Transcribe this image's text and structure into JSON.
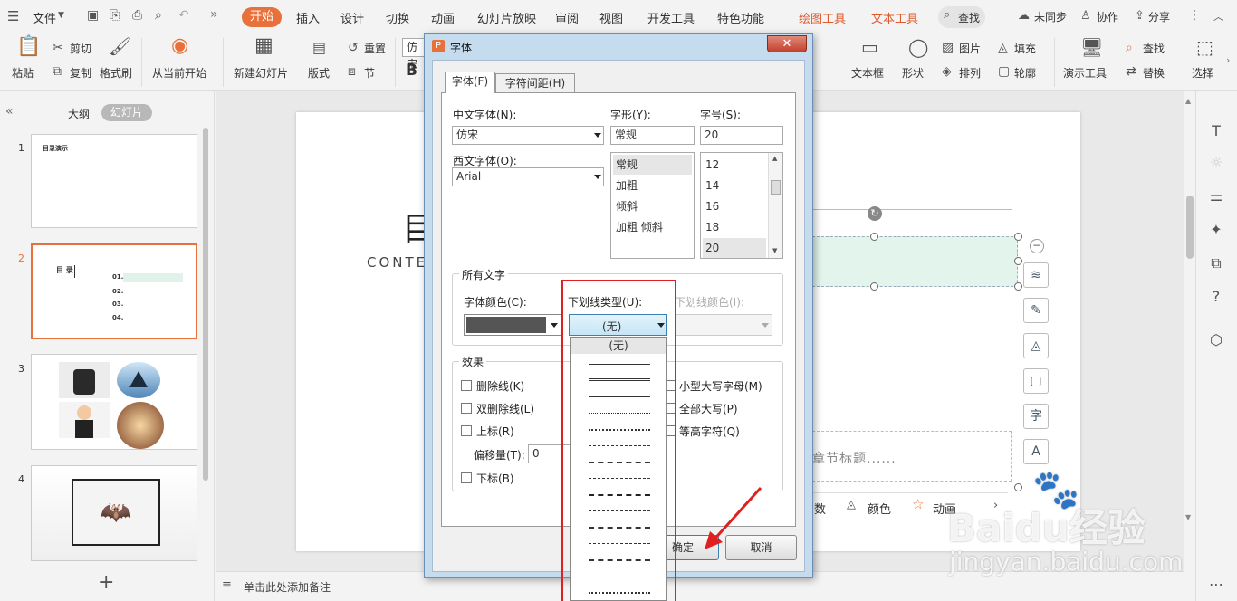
{
  "menubar": {
    "file": "文件",
    "more": "»",
    "tabs": [
      "开始",
      "插入",
      "设计",
      "切换",
      "动画",
      "幻灯片放映",
      "审阅",
      "视图",
      "开发工具",
      "特色功能"
    ],
    "tool_tabs": [
      "绘图工具",
      "文本工具"
    ],
    "search": "查找",
    "sync": "未同步",
    "collab": "协作",
    "share": "分享"
  },
  "ribbon": {
    "paste": "粘贴",
    "cut": "剪切",
    "copy": "复制",
    "format_painter": "格式刷",
    "from_current": "从当前开始",
    "new_slide": "新建幻灯片",
    "layout": "版式",
    "reset": "重置",
    "section": "节",
    "font_name": "仿宋",
    "bold": "B",
    "textbox": "文本框",
    "shape": "形状",
    "picture": "图片",
    "arrange": "排列",
    "fill": "填充",
    "outline": "轮廓",
    "present_tools": "演示工具",
    "find": "查找",
    "replace": "替换",
    "select": "选择"
  },
  "leftpanel": {
    "outline_tab": "大纲",
    "slides_tab": "幻灯片",
    "slide_numbers": [
      "1",
      "2",
      "3",
      "4"
    ],
    "thumb1_title": "目录演示",
    "thumb2_title": "目 录",
    "thumb2_items": [
      "01.",
      "02.",
      "03.",
      "04."
    ],
    "add": "+"
  },
  "slide": {
    "title_char": "目",
    "subtitle": "CONTE",
    "chapter_placeholder": "章节标题......",
    "toolbar_items": [
      "数",
      "颜色",
      "动画"
    ]
  },
  "notes": {
    "placeholder": "单击此处添加备注"
  },
  "dialog": {
    "title": "字体",
    "tabs": [
      "字体(F)",
      "字符间距(H)"
    ],
    "cn_font_label": "中文字体(N):",
    "cn_font_value": "仿宋",
    "style_label": "字形(Y):",
    "style_value": "常规",
    "size_label": "字号(S):",
    "size_value": "20",
    "west_font_label": "西文字体(O):",
    "west_font_value": "Arial",
    "style_options": [
      "常规",
      "加粗",
      "倾斜",
      "加粗 倾斜"
    ],
    "size_options": [
      "12",
      "14",
      "16",
      "18",
      "20"
    ],
    "all_text_label": "所有文字",
    "font_color_label": "字体颜色(C):",
    "underline_type_label": "下划线类型(U):",
    "underline_color_label": "下划线颜色(I):",
    "underline_value": "(无)",
    "underline_dropdown_first": "(无)",
    "effects_label": "效果",
    "effects_left": [
      "删除线(K)",
      "双删除线(L)",
      "上标(R)",
      "下标(B)"
    ],
    "offset_label": "偏移量(T):",
    "offset_value": "0",
    "effects_right": [
      "小型大写字母(M)",
      "全部大写(P)",
      "等高字符(Q)"
    ],
    "ok": "确定",
    "cancel": "取消"
  },
  "watermark": {
    "line1": "Baidu经验",
    "line2": "jingyan.baidu.com"
  },
  "colors": {
    "accent": "#e8703a",
    "tool_tab": "#e05a2b",
    "highlight_box": "#e02020",
    "selected_slide_border": "#e8703a"
  }
}
